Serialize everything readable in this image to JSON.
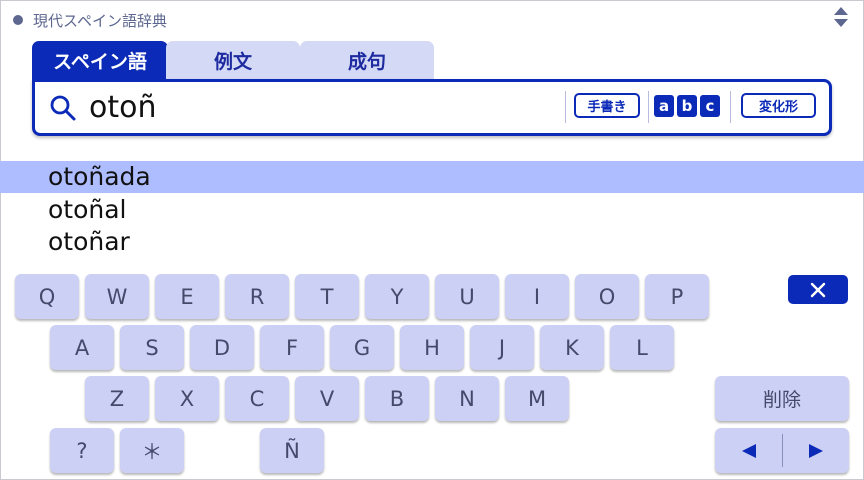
{
  "header": {
    "title": "現代スペイン語辞典",
    "sort_icon": "up-down-triangle-icon"
  },
  "tabs": [
    {
      "label": "スペイン語",
      "active": true
    },
    {
      "label": "例文",
      "active": false
    },
    {
      "label": "成句",
      "active": false
    }
  ],
  "search": {
    "value": "otoñ",
    "icon": "magnifier-icon",
    "handwriting_label": "手書き",
    "abc_labels": [
      "a",
      "b",
      "c"
    ],
    "conjugation_label": "変化形"
  },
  "results": [
    {
      "text": "otoñada",
      "selected": true
    },
    {
      "text": "otoñal",
      "selected": false
    },
    {
      "text": "otoñar",
      "selected": false
    }
  ],
  "keyboard": {
    "row1": [
      "Q",
      "W",
      "E",
      "R",
      "T",
      "Y",
      "U",
      "I",
      "O",
      "P"
    ],
    "row2": [
      "A",
      "S",
      "D",
      "F",
      "G",
      "H",
      "J",
      "K",
      "L"
    ],
    "row3": [
      "Z",
      "X",
      "C",
      "V",
      "B",
      "N",
      "M"
    ],
    "row4": [
      "?",
      "＊",
      "Ñ"
    ],
    "delete_label": "削除",
    "close_icon": "close-x-icon",
    "arrow_left_icon": "left-triangle-icon",
    "arrow_right_icon": "right-triangle-icon"
  },
  "colors": {
    "accent": "#0c2ab8",
    "key_bg": "#ccd0f5",
    "selected_row": "#aebdff"
  }
}
